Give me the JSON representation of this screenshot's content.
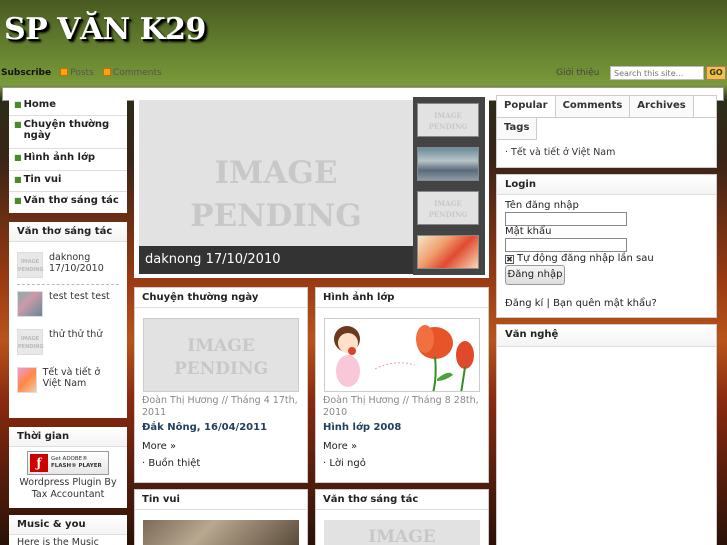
{
  "header": {
    "site_title": "SP VĂN K29",
    "subscribe": "Subscribe",
    "posts": "Posts",
    "comments": "Comments",
    "about": "Giới thiệu",
    "search_placeholder": "Search this site...",
    "go": "GO"
  },
  "sidebar": {
    "nav": [
      "Home",
      "Chuyện thường ngày",
      "Hình ảnh lớp",
      "Tin vui",
      "Văn thơ sáng tác"
    ],
    "van_tho_title": "Văn thơ sáng tác",
    "van_tho_items": [
      "daknong 17/10/2010",
      "test test test",
      "thử thử thử",
      "Tết và tiết ở Việt Nam"
    ],
    "thoi_gian_title": "Thời gian",
    "flash_badge_1": "Get ADOBE®",
    "flash_badge_2": "FLASH® PLAYER",
    "plugin_text": "Wordpress Plugin By Tax Accountant",
    "music_title": "Music & you",
    "music_text": "Here is the Music"
  },
  "featured": {
    "pending_1": "IMAGE",
    "pending_2": "PENDING",
    "caption": "daknong 17/10/2010"
  },
  "posts": [
    {
      "category": "Chuyện thường ngày",
      "meta": "Đoàn Thị Hương // Tháng 4 17th, 2011",
      "title": "Đắk Nông, 16/04/2011",
      "more": "More »",
      "related": "· Buồn thiệt"
    },
    {
      "category": "Hình ảnh lớp",
      "meta": "Đoàn Thị Hương // Tháng 8 28th, 2010",
      "title": "Hình lớp 2008",
      "more": "More »",
      "related": "· Lời ngỏ"
    },
    {
      "category": "Tin vui"
    },
    {
      "category": "Văn thơ sáng tác"
    }
  ],
  "right": {
    "tabs": [
      "Popular",
      "Comments",
      "Archives",
      "Tags"
    ],
    "popular_item": "· Tết và tiết ở Việt Nam",
    "login_title": "Login",
    "username_label": "Tên đăng nhập",
    "password_label": "Mật khẩu",
    "remember_label": "Tự động đăng nhập lần sau",
    "login_button": "Đăng nhập",
    "register": "Đăng kí",
    "sep": "|",
    "forgot": "Bạn quên mật khẩu?",
    "van_nghe_title": "Văn nghệ"
  },
  "colors": {
    "accent": "#f2c23a",
    "link": "#23405e",
    "bullet": "#4a8a2a"
  }
}
